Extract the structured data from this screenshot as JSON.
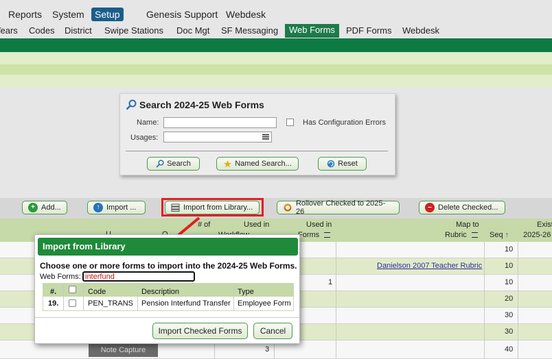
{
  "top_menu": {
    "reports": "Reports",
    "system": "System",
    "setup": "Setup",
    "genesis_support": "Genesis Support",
    "webdesk": "Webdesk"
  },
  "tabs": {
    "years": "Years",
    "codes": "Codes",
    "district": "District",
    "swipe_stations": "Swipe Stations",
    "doc_mgt": "Doc Mgt",
    "sf_messaging": "SF Messaging",
    "web_forms": "Web Forms",
    "pdf_forms": "PDF Forms",
    "webdesk": "Webdesk"
  },
  "search": {
    "title": "Search 2024-25 Web Forms",
    "name_label": "Name:",
    "usages_label": "Usages:",
    "config_errors_label": "Has Configuration Errors",
    "search_btn": "Search",
    "named_search_btn": "Named Search...",
    "reset_btn": "Reset"
  },
  "actions": {
    "add": "Add...",
    "import": "Import ...",
    "import_library": "Import from Library...",
    "rollover": "Rollover Checked to 2025-26",
    "delete": "Delete Checked..."
  },
  "grid": {
    "headers": {
      "col_u": "U",
      "col_o": "O",
      "num_of": "# of",
      "workflow": "Workflow",
      "used_in_1": "Used in",
      "used_in_2": "Used in",
      "forms": "Forms",
      "map_to": "Map to",
      "rubric": "Rubric",
      "seq": "Seq",
      "exist": "Exist",
      "year_2025_26": "2025-26"
    },
    "rows": [
      {
        "used_in_2": "",
        "rubric": "",
        "seq": "10"
      },
      {
        "used_in_2": "",
        "rubric": "Danielson 2007 Teacher Rubric",
        "seq": "10"
      },
      {
        "used_in_2": "1",
        "rubric": "",
        "seq": "10"
      },
      {
        "used_in_2": "",
        "rubric": "",
        "seq": "20"
      },
      {
        "used_in_2": "",
        "rubric": "",
        "seq": "30"
      },
      {
        "used_in_2": "",
        "rubric": "",
        "seq": "30"
      },
      {
        "used_in_2": "",
        "rubric": "",
        "seq": "40"
      }
    ],
    "last_row_name": "Note Capture",
    "last_row_workflow": "3"
  },
  "dialog": {
    "title": "Import from Library",
    "prompt": "Choose one or more forms to import into the 2024-25 Web Forms.",
    "filter_label": "Web Forms:",
    "filter_value": "interfund",
    "table_headers": {
      "num": "#.",
      "code": "Code",
      "description": "Description",
      "type": "Type"
    },
    "row": {
      "num": "19.",
      "code": "PEN_TRANS",
      "description": "Pension Interfund Transfer",
      "type": "Employee Form"
    },
    "import_btn": "Import Checked Forms",
    "cancel_btn": "Cancel"
  },
  "colors": {
    "accent_green": "#1f8a3a",
    "highlight_red": "#e02020",
    "setup_blue": "#1a5e8a"
  }
}
